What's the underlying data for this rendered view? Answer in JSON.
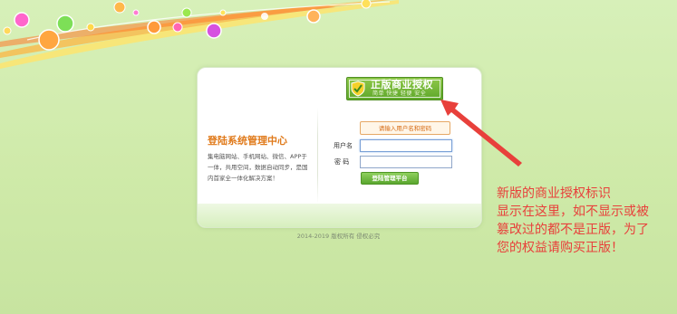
{
  "badge": {
    "title": "正版商业授权",
    "subtitle": "简单  快捷  轻便  安全"
  },
  "system": {
    "title": "登陆系统管理中心",
    "description": "集电脑网站、手机网站、微信、APP于一体，共用空间，数据自动同步，是国内首家全一体化解决方案！"
  },
  "login": {
    "hint": "请输入用户名和密码",
    "username_label": "用户名",
    "username_value": "",
    "password_label": "密  码",
    "password_value": "",
    "submit_label": "登陆管理平台"
  },
  "footer": {
    "copyright": "2014-2019  版权所有  侵权必究"
  },
  "note": {
    "lines": [
      "新版的商业授权标识",
      "显示在这里，如不显示或被",
      "篡改过的都不是正版，为了",
      "您的权益请购买正版！"
    ]
  },
  "colors": {
    "background": "#d7f0b9",
    "badge_green": "#5ea72a",
    "title_orange": "#e07a1b",
    "note_red": "#e8403b"
  }
}
